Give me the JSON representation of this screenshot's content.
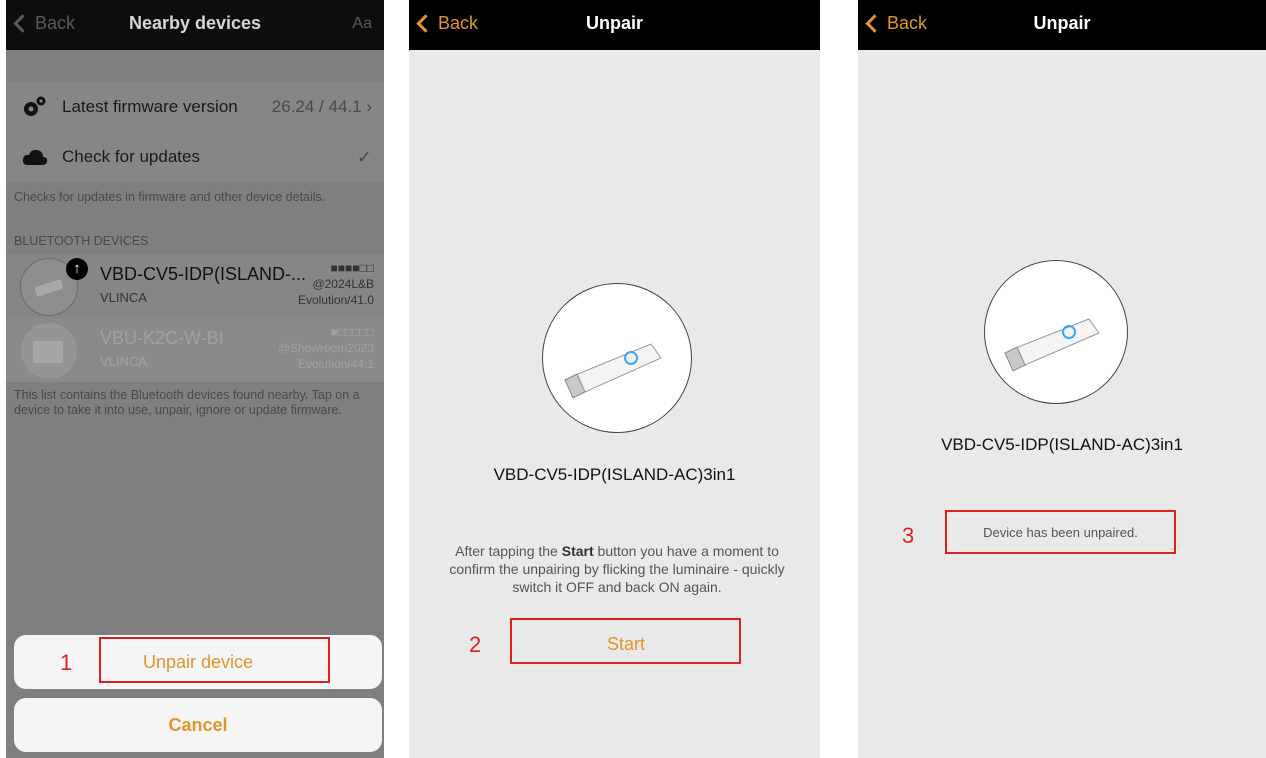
{
  "screen1": {
    "back_label": "Back",
    "title": "Nearby devices",
    "font_button": "Aa",
    "firmware_label": "Latest firmware version",
    "firmware_value": "26.24 / 44.1",
    "check_updates_label": "Check for updates",
    "updates_note": "Checks for updates in firmware and other device details.",
    "section_header": "BLUETOOTH DEVICES",
    "devices": [
      {
        "name": "VBD-CV5-IDP(ISLAND-...",
        "brand": "VLINCA",
        "signal": "■■■■□□",
        "tag": "@2024L&B",
        "version": "Evolution/41.0"
      },
      {
        "name": "VBU-K2C-W-BI",
        "brand": "VLINCA",
        "signal": "■□□□□□",
        "tag": "@Showroom2023",
        "version": "Evolution/44.1"
      }
    ],
    "list_note": "This list contains the Bluetooth devices found nearby. Tap on a device to take it into use, unpair, ignore or update firmware.",
    "unpair_button": "Unpair device",
    "cancel_button": "Cancel",
    "step": "1"
  },
  "screen2": {
    "back_label": "Back",
    "title": "Unpair",
    "device_name": "VBD-CV5-IDP(ISLAND-AC)3in1",
    "instruction_pre": "After tapping the ",
    "instruction_bold": "Start",
    "instruction_post": " button you have a moment to confirm the unpairing by flicking the luminaire - quickly switch it OFF and back ON again.",
    "start_button": "Start",
    "step": "2"
  },
  "screen3": {
    "back_label": "Back",
    "title": "Unpair",
    "device_name": "VBD-CV5-IDP(ISLAND-AC)3in1",
    "status": "Device has been unpaired.",
    "step": "3"
  },
  "colors": {
    "accent": "#e0962a",
    "highlight": "#e02020",
    "navbar": "#000000"
  }
}
